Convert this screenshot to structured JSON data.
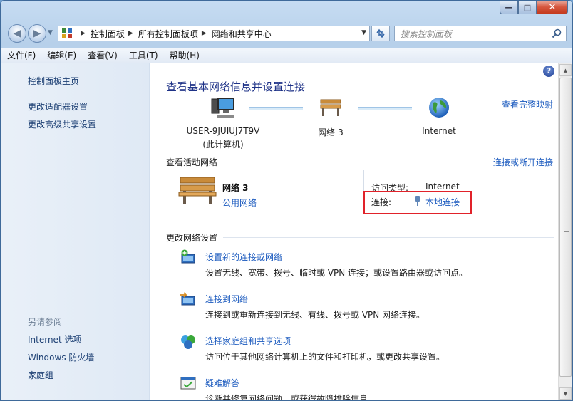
{
  "window": {
    "caption": {
      "minimize": "—",
      "maximize": "□",
      "close": "✕"
    }
  },
  "nav": {
    "back_icon": "back-arrow-icon",
    "forward_icon": "forward-arrow-icon",
    "breadcrumbs": [
      "控制面板",
      "所有控制面板项",
      "网络和共享中心"
    ],
    "search_placeholder": "搜索控制面板"
  },
  "menu": [
    "文件(F)",
    "编辑(E)",
    "查看(V)",
    "工具(T)",
    "帮助(H)"
  ],
  "sidebar": {
    "links": [
      "控制面板主页",
      "更改适配器设置",
      "更改高级共享设置"
    ],
    "see_also_header": "另请参阅",
    "see_also": [
      "Internet 选项",
      "Windows 防火墙",
      "家庭组"
    ]
  },
  "main": {
    "title": "查看基本网络信息并设置连接",
    "full_map_link": "查看完整映射",
    "map": {
      "computer_name": "USER-9JUIUJ7T9V",
      "computer_sub": "(此计算机)",
      "network_name": "网络  3",
      "internet_name": "Internet"
    },
    "active": {
      "title": "查看活动网络",
      "connect_link": "连接或断开连接",
      "network_name": "网络  3",
      "network_type": "公用网络",
      "access_label": "访问类型:",
      "access_value": "Internet",
      "connection_label": "连接:",
      "connection_value": "本地连接"
    },
    "change": {
      "title": "更改网络设置",
      "tasks": [
        {
          "link": "设置新的连接或网络",
          "desc": "设置无线、宽带、拨号、临时或 VPN 连接；或设置路由器或访问点。"
        },
        {
          "link": "连接到网络",
          "desc": "连接到或重新连接到无线、有线、拨号或 VPN 网络连接。"
        },
        {
          "link": "选择家庭组和共享选项",
          "desc": "访问位于其他网络计算机上的文件和打印机，或更改共享设置。"
        },
        {
          "link": "疑难解答",
          "desc": "诊断并修复网络问题，或获得故障排除信息。"
        }
      ]
    }
  },
  "colors": {
    "link": "#1c5bbf",
    "title": "#1e3287",
    "highlight": "#e1222a"
  }
}
